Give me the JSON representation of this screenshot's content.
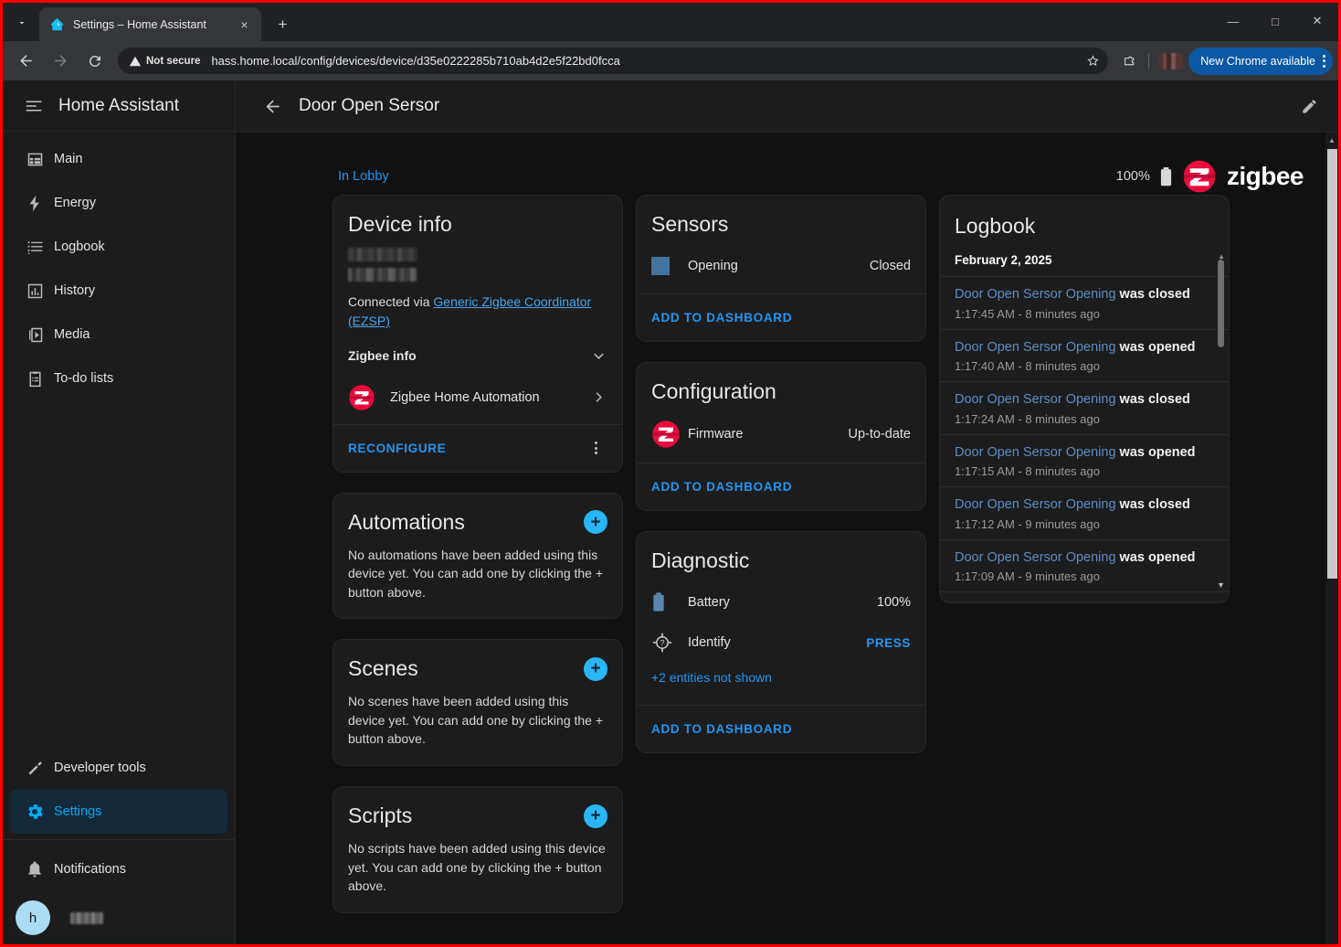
{
  "browser": {
    "tab_title": "Settings – Home Assistant",
    "tab_close_label": "×",
    "new_tab_label": "+",
    "security_label": "Not secure",
    "url": "hass.home.local/config/devices/device/d35e0222285b710ab4d2e5f22bd0fcca",
    "chrome_update_label": "New Chrome available",
    "window_minimize": "—",
    "window_maximize": "□",
    "window_close": "✕"
  },
  "sidebar": {
    "title": "Home Assistant",
    "items": [
      {
        "label": "Main",
        "icon": "dashboard-icon"
      },
      {
        "label": "Energy",
        "icon": "lightning-icon"
      },
      {
        "label": "Logbook",
        "icon": "list-icon"
      },
      {
        "label": "History",
        "icon": "chart-icon"
      },
      {
        "label": "Media",
        "icon": "media-icon"
      },
      {
        "label": "To-do lists",
        "icon": "clipboard-icon"
      }
    ],
    "bottom_items": [
      {
        "label": "Developer tools",
        "icon": "hammer-icon",
        "active": false
      },
      {
        "label": "Settings",
        "icon": "gear-icon",
        "active": true
      }
    ],
    "notifications_label": "Notifications",
    "user_initial": "h"
  },
  "header": {
    "title": "Door Open Sersor"
  },
  "topbar": {
    "area_label": "In Lobby",
    "battery_percent": "100%",
    "zigbee_word": "zigbee"
  },
  "device_info": {
    "title": "Device info",
    "connected_prefix": "Connected via ",
    "connected_link": "Generic Zigbee Coordinator (EZSP)",
    "zigbee_info_label": "Zigbee info",
    "integration_name": "Zigbee Home Automation",
    "reconfigure_label": "RECONFIGURE"
  },
  "automations": {
    "title": "Automations",
    "empty_text": "No automations have been added using this device yet. You can add one by clicking the + button above.",
    "add_label": "+"
  },
  "scenes": {
    "title": "Scenes",
    "empty_text": "No scenes have been added using this device yet. You can add one by clicking the + button above.",
    "add_label": "+"
  },
  "scripts": {
    "title": "Scripts",
    "empty_text": "No scripts have been added using this device yet. You can add one by clicking the + button above.",
    "add_label": "+"
  },
  "sensors": {
    "title": "Sensors",
    "rows": [
      {
        "name": "Opening",
        "value": "Closed",
        "icon": "window-closed-icon"
      }
    ],
    "add_to_dashboard_label": "ADD TO DASHBOARD"
  },
  "configuration": {
    "title": "Configuration",
    "rows": [
      {
        "name": "Firmware",
        "value": "Up-to-date",
        "icon": "zigbee-icon"
      }
    ],
    "add_to_dashboard_label": "ADD TO DASHBOARD"
  },
  "diagnostic": {
    "title": "Diagnostic",
    "rows": [
      {
        "name": "Battery",
        "value": "100%",
        "icon": "battery-icon"
      },
      {
        "name": "Identify",
        "value": "PRESS",
        "icon": "identify-crosshair-icon"
      }
    ],
    "more_entities_label": "+2 entities not shown",
    "add_to_dashboard_label": "ADD TO DASHBOARD"
  },
  "logbook": {
    "title": "Logbook",
    "date": "February 2, 2025",
    "entries": [
      {
        "entity": "Door Open Sersor Opening",
        "action": "was closed",
        "time": "1:17:45 AM - 8 minutes ago"
      },
      {
        "entity": "Door Open Sersor Opening",
        "action": "was opened",
        "time": "1:17:40 AM - 8 minutes ago"
      },
      {
        "entity": "Door Open Sersor Opening",
        "action": "was closed",
        "time": "1:17:24 AM - 8 minutes ago"
      },
      {
        "entity": "Door Open Sersor Opening",
        "action": "was opened",
        "time": "1:17:15 AM - 8 minutes ago"
      },
      {
        "entity": "Door Open Sersor Opening",
        "action": "was closed",
        "time": "1:17:12 AM - 9 minutes ago"
      },
      {
        "entity": "Door Open Sersor Opening",
        "action": "was opened",
        "time": "1:17:09 AM - 9 minutes ago"
      }
    ]
  },
  "colors": {
    "accent_blue": "#2196f3",
    "zigbee_red": "#eb0a3c",
    "window_icon_blue": "#44739e",
    "sidebar_active_bg": "#13293a"
  }
}
